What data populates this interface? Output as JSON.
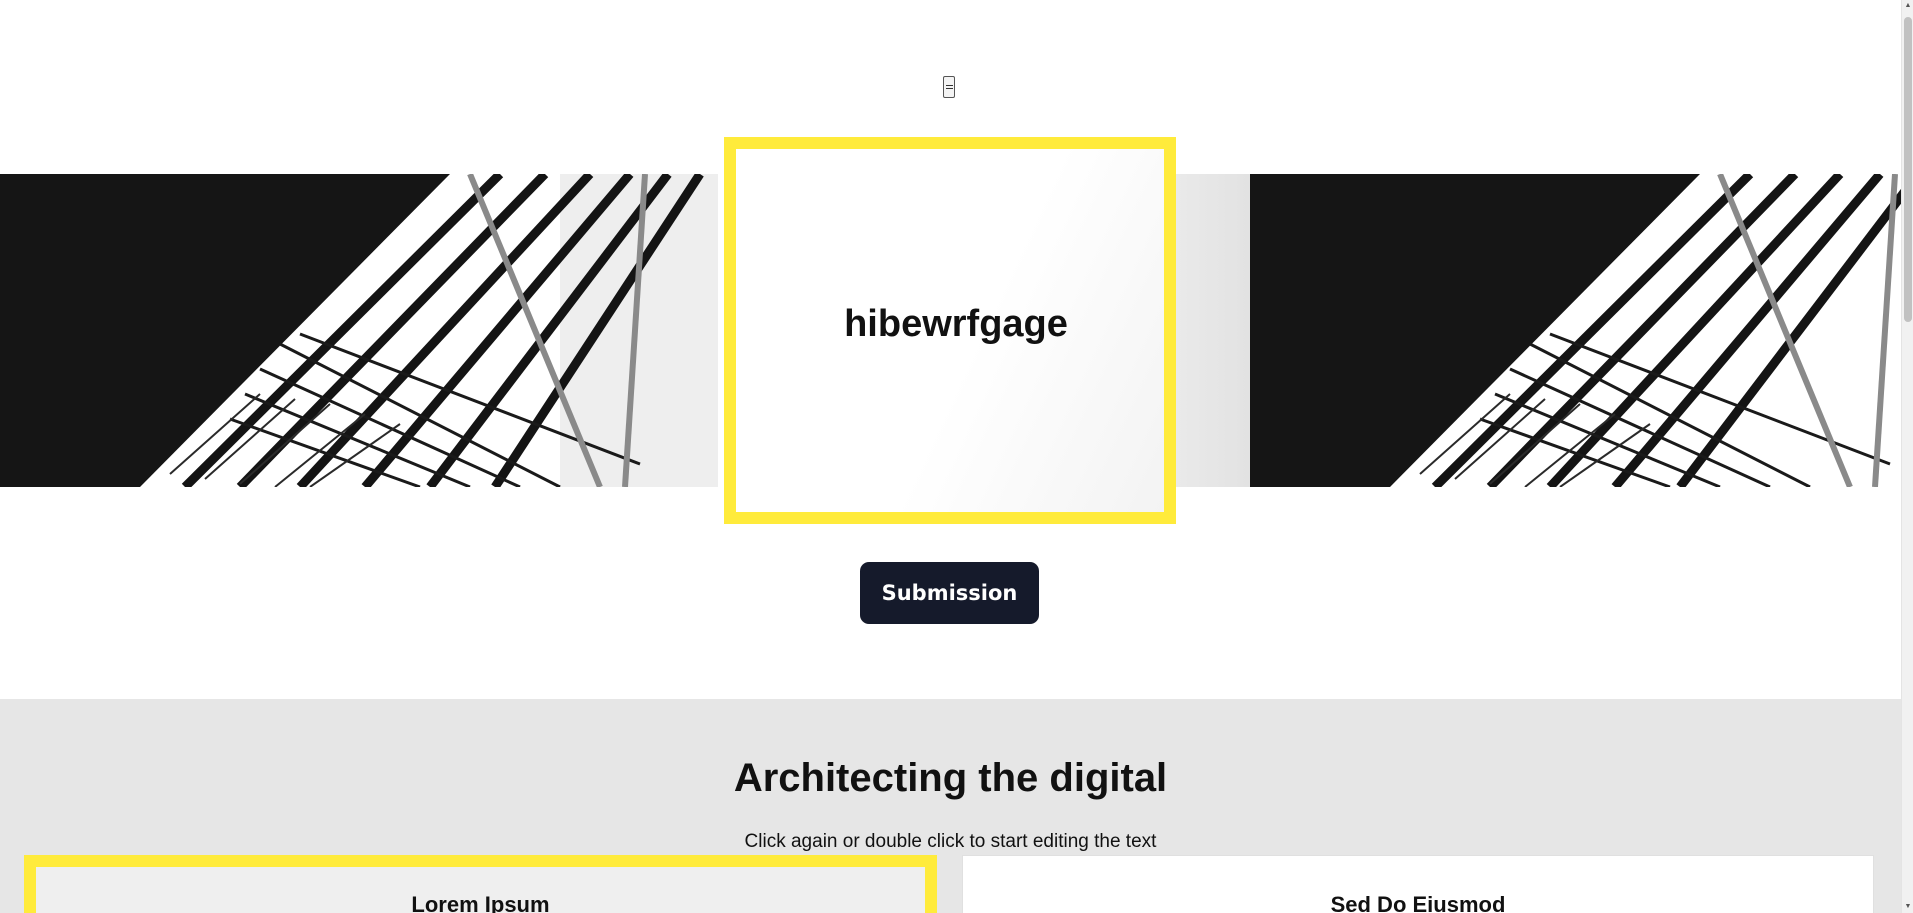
{
  "header": {
    "menu_icon": "hamburger-menu-icon"
  },
  "hero": {
    "title": "hibewrfgage",
    "image_icon": "architecture-building-image",
    "highlight_color": "#ffeb3b"
  },
  "actions": {
    "submit_label": "Submission",
    "button_color": "#151a2b"
  },
  "section": {
    "title": "Architecting the digital",
    "subtitle": "Click again or double click to start editing the text",
    "background_color": "#e6e6e6",
    "cards": [
      {
        "title": "Lorem Ipsum"
      },
      {
        "title": "Sed Do Eiusmod"
      }
    ]
  },
  "scrollbar": {
    "up_icon": "scroll-up-arrow-icon",
    "down_icon": "scroll-down-arrow-icon"
  }
}
